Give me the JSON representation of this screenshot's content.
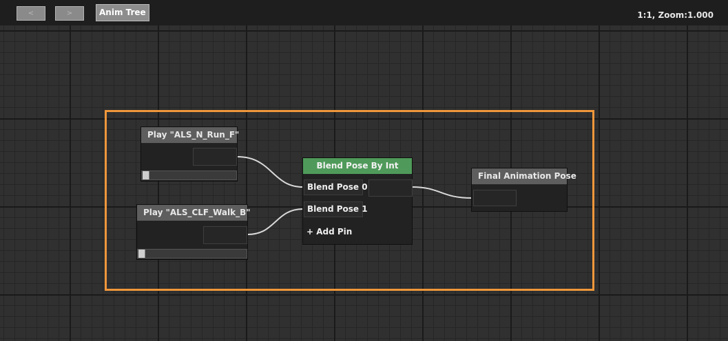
{
  "toolbar": {
    "back_label": "<",
    "forward_label": ">",
    "tab_label": "Anim Tree",
    "zoom_text": "1:1, Zoom:1.000"
  },
  "nodes": {
    "play_run": {
      "title": "Play \"ALS_N_Run_F\""
    },
    "play_walk": {
      "title": "Play \"ALS_CLF_Walk_B\""
    },
    "blend": {
      "title": "Blend Pose By Int",
      "pin0": "Blend Pose 0",
      "pin1": "Blend Pose 1",
      "add_pin": "+ Add Pin"
    },
    "final": {
      "title": "Final Animation Pose"
    }
  },
  "colors": {
    "comment_border": "#f0973a",
    "blend_header": "#4f9a5a",
    "wire": "#d9d9d9"
  }
}
